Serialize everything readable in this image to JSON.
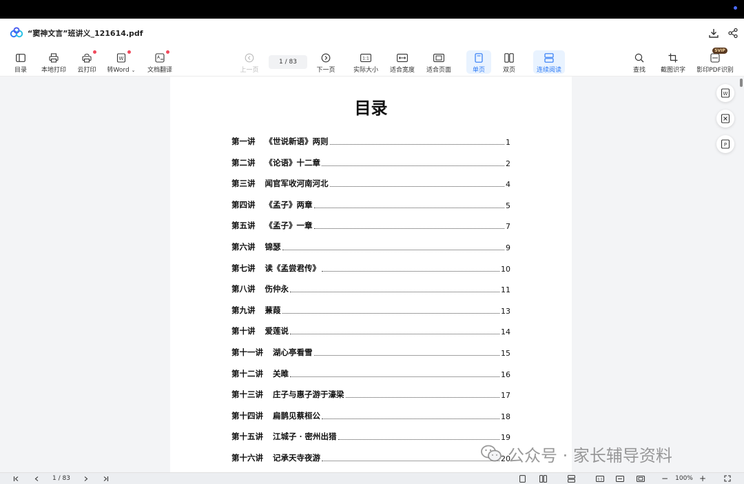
{
  "window": {
    "title": "“窦神文言”班讲义_121614.pdf"
  },
  "toolbar": {
    "toc": "目录",
    "local_print": "本地打印",
    "cloud_print": "云打印",
    "to_word": "转Word",
    "doc_translate": "文档翻译",
    "prev_page": "上一页",
    "page_indicator": "1  /  83",
    "next_page": "下一页",
    "actual_size": "实际大小",
    "fit_width": "适合宽度",
    "fit_page": "适合页面",
    "single_page": "单页",
    "double_page": "双页",
    "continuous": "连续阅读",
    "find": "查找",
    "screenshot_ocr": "截图识字",
    "ocr_pdf": "影印PDF识别",
    "svip": "SVIP"
  },
  "document": {
    "heading": "目录",
    "toc": [
      {
        "lecture": "第一讲",
        "title": "《世说新语》两则",
        "page": "1"
      },
      {
        "lecture": "第二讲",
        "title": "《论语》十二章",
        "page": "2"
      },
      {
        "lecture": "第三讲",
        "title": "闻官军收河南河北",
        "page": "4"
      },
      {
        "lecture": "第四讲",
        "title": "《孟子》两章",
        "page": "5"
      },
      {
        "lecture": "第五讲",
        "title": "《孟子》一章",
        "page": "7"
      },
      {
        "lecture": "第六讲",
        "title": "锦瑟",
        "page": "9"
      },
      {
        "lecture": "第七讲",
        "title": "读《孟尝君传》",
        "page": "10"
      },
      {
        "lecture": "第八讲",
        "title": "伤仲永",
        "page": "11"
      },
      {
        "lecture": "第九讲",
        "title": "蒹葭",
        "page": "13"
      },
      {
        "lecture": "第十讲",
        "title": "爱莲说",
        "page": "14"
      },
      {
        "lecture": "第十一讲",
        "title": "湖心亭看雪",
        "page": "15"
      },
      {
        "lecture": "第十二讲",
        "title": "关雎",
        "page": "16"
      },
      {
        "lecture": "第十三讲",
        "title": "庄子与惠子游于濠梁",
        "page": "17"
      },
      {
        "lecture": "第十四讲",
        "title": "扁鹊见蔡桓公",
        "page": "18"
      },
      {
        "lecture": "第十五讲",
        "title": "江城子 · 密州出猎",
        "page": "19"
      },
      {
        "lecture": "第十六讲",
        "title": "记承天寺夜游",
        "page": "20"
      }
    ]
  },
  "watermark": {
    "text": "公众号 · 家长辅导资料"
  },
  "statusbar": {
    "page_indicator": "1  /  83",
    "zoom": "100%",
    "zoom_out": "−",
    "zoom_in": "+"
  }
}
